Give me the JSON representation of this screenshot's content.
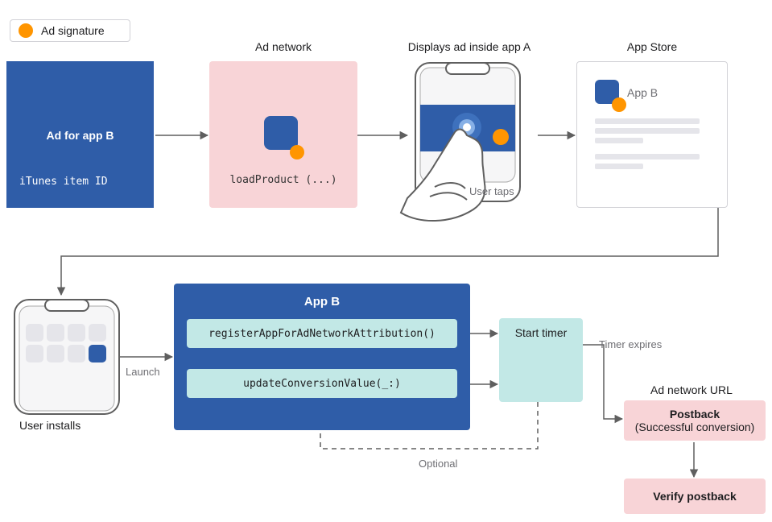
{
  "legend": {
    "label": "Ad signature"
  },
  "ad_box": {
    "title": "Ad for app B",
    "subtitle": "iTunes item ID"
  },
  "ad_network": {
    "header": "Ad network",
    "code": "loadProduct (...)"
  },
  "display_phone": {
    "header": "Displays ad inside app A",
    "caption": "User taps"
  },
  "app_store": {
    "header": "App Store",
    "app_label": "App B"
  },
  "installs_phone": {
    "caption": "User installs",
    "launch_label": "Launch"
  },
  "app_b": {
    "title": "App B",
    "api_register": "registerAppForAdNetworkAttribution()",
    "api_update": "updateConversionValue(_:)",
    "optional_label": "Optional"
  },
  "timer": {
    "title": "Start timer",
    "expires_label": "Timer expires"
  },
  "postback": {
    "header": "Ad network URL",
    "title": "Postback",
    "subtitle": "(Successful conversion)",
    "verify": "Verify postback"
  },
  "colors": {
    "blue": "#2F5DA8",
    "pink": "#f8d4d7",
    "mint": "#c2e8e6",
    "orange": "#ff9500",
    "gray_line": "#5f5f5f"
  }
}
